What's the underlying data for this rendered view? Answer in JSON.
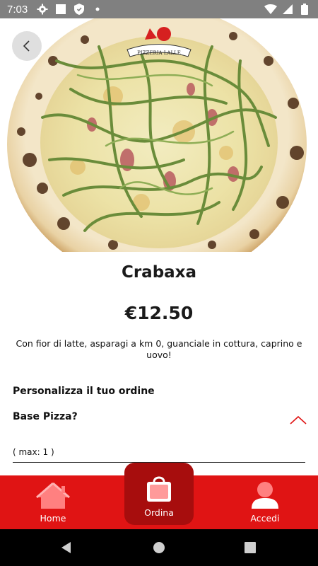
{
  "status_bar": {
    "time": "7:03",
    "icons": [
      "settings-icon",
      "square-icon",
      "shield-icon",
      "notification-dot-icon",
      "wifi-icon",
      "signal-icon",
      "battery-icon"
    ]
  },
  "hero": {
    "logo_text": "PIZZERIA LALLE",
    "image_subject": "pizza"
  },
  "product": {
    "name": "Crabaxa",
    "price": "€12.50",
    "description": "Con fior di latte, asparagi a km 0, guanciale in cottura, caprino e uovo!"
  },
  "customize": {
    "section_title": "Personalizza il tuo ordine",
    "option_title": "Base Pizza?",
    "max_label": "( max: 1 )"
  },
  "bottom_nav": {
    "home_label": "Home",
    "order_label": "Ordina",
    "login_label": "Accedi"
  },
  "colors": {
    "accent_red": "#e01414",
    "dark_red": "#a70d0d",
    "status_bar": "#808080"
  }
}
